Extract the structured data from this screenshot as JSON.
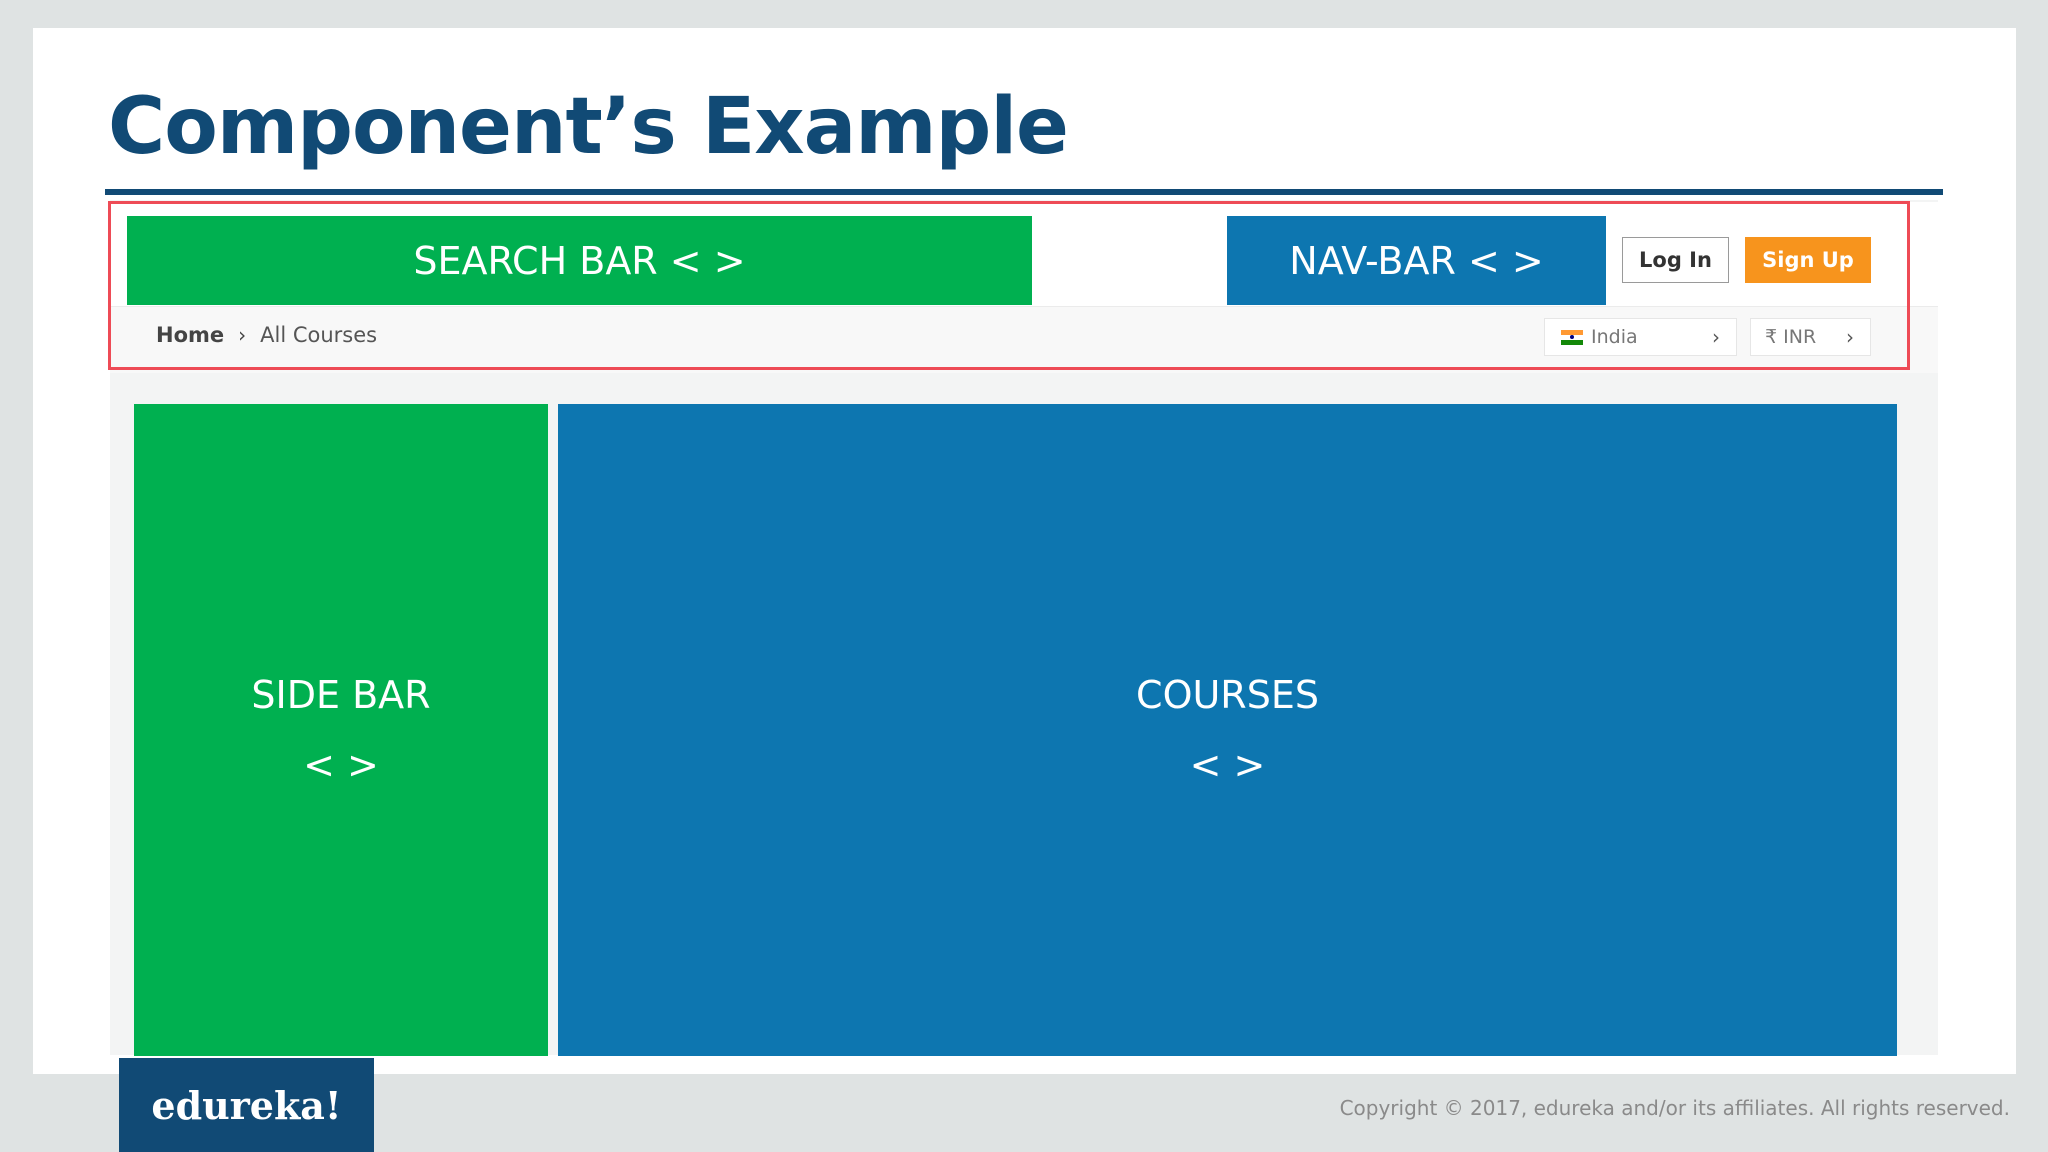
{
  "slide": {
    "title": "Component’s Example"
  },
  "mockup": {
    "search_bar": "SEARCH BAR < >",
    "nav_bar": "NAV-BAR < >",
    "login_label": "Log In",
    "signup_label": "Sign Up",
    "breadcrumb": {
      "home": "Home",
      "separator": "›",
      "current": "All Courses"
    },
    "country": {
      "label": "India",
      "flag_icon": "india-flag-icon",
      "chevron": "›"
    },
    "currency": {
      "label": "₹ INR",
      "chevron": "›"
    },
    "side_bar": {
      "label": "SIDE BAR",
      "tag": "< >"
    },
    "courses": {
      "label": "COURSES",
      "tag": "< >"
    }
  },
  "footer": {
    "logo": "edureka!",
    "copyright": "Copyright © 2017, edureka and/or its affiliates. All rights reserved."
  },
  "colors": {
    "title": "#114a75",
    "green_block": "#00b050",
    "blue_block": "#0d76b0",
    "highlight_border": "#ee4b56",
    "signup": "#f7941d"
  }
}
